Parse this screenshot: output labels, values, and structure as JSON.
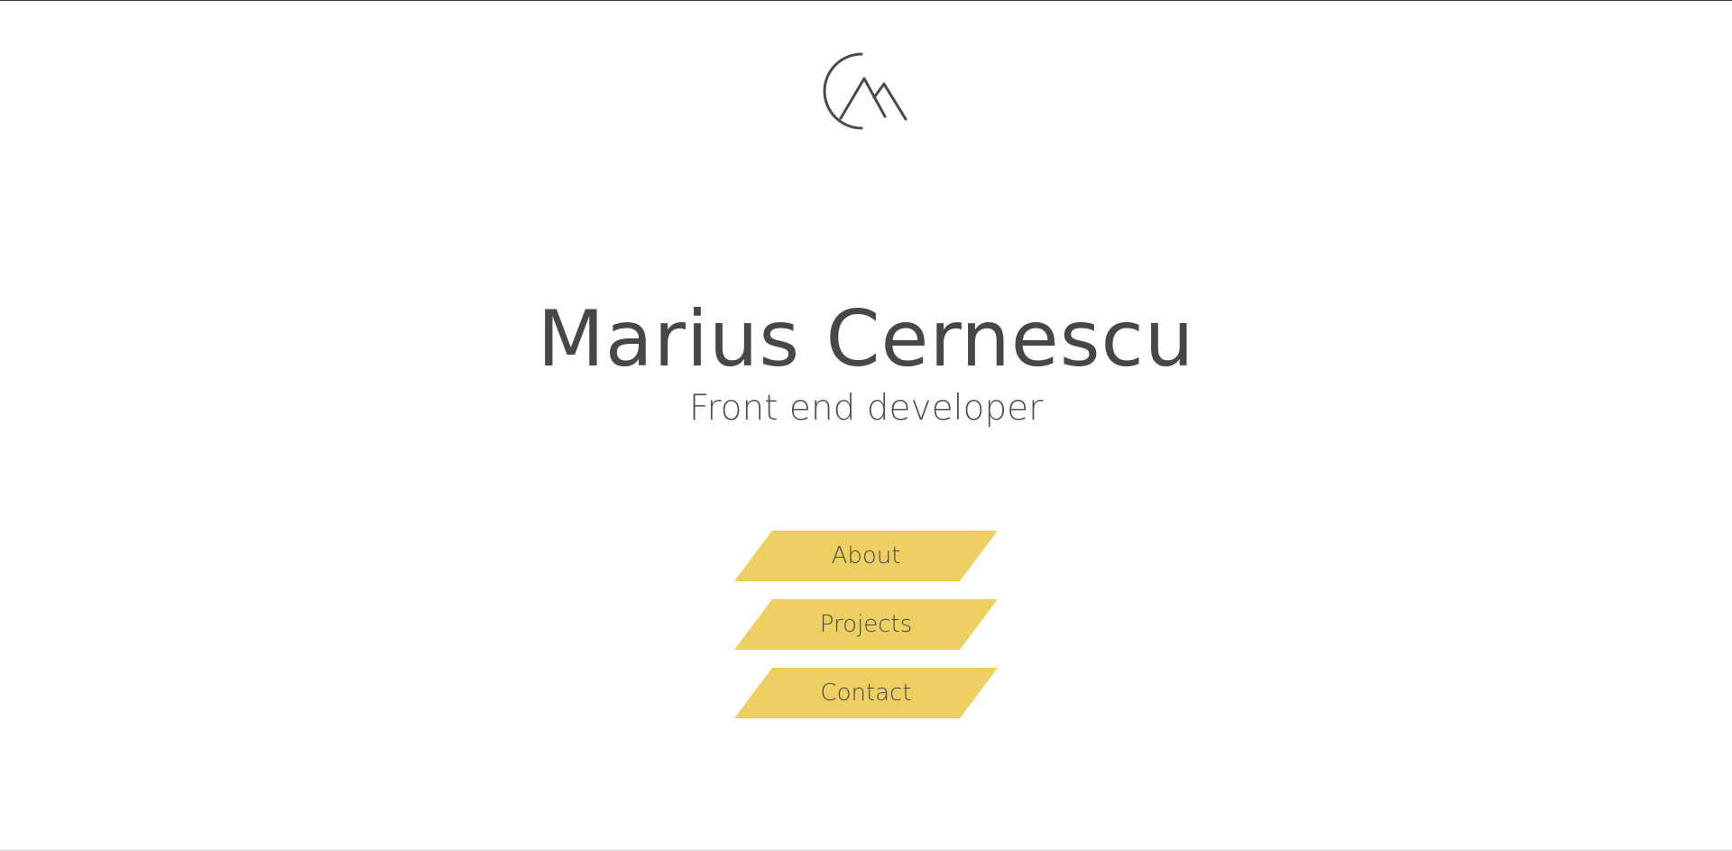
{
  "header": {
    "logo_icon": "cm-mountain-logo-icon"
  },
  "hero": {
    "name": "Marius Cernescu",
    "role": "Front end developer"
  },
  "nav": {
    "items": [
      {
        "label": "About"
      },
      {
        "label": "Projects"
      },
      {
        "label": "Contact"
      }
    ]
  },
  "colors": {
    "accent": "#eecf61",
    "text": "#474747",
    "background": "#ffffff"
  }
}
